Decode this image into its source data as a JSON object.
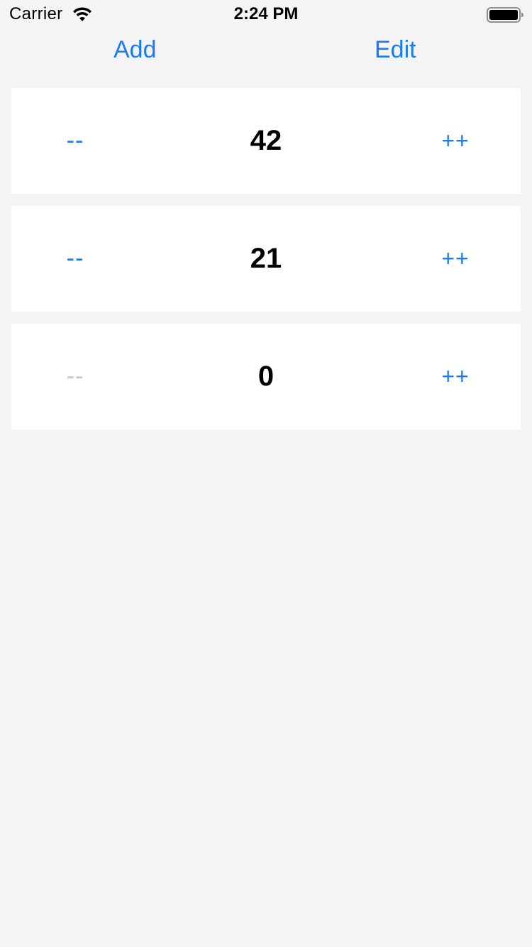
{
  "status_bar": {
    "carrier": "Carrier",
    "time": "2:24 PM"
  },
  "nav": {
    "add_label": "Add",
    "edit_label": "Edit"
  },
  "counters": [
    {
      "value": "42",
      "decrement_label": "--",
      "increment_label": "++",
      "decrement_enabled": true
    },
    {
      "value": "21",
      "decrement_label": "--",
      "increment_label": "++",
      "decrement_enabled": true
    },
    {
      "value": "0",
      "decrement_label": "--",
      "increment_label": "++",
      "decrement_enabled": false
    }
  ],
  "colors": {
    "accent": "#1a7cf0",
    "disabled": "#c8c8cc",
    "background": "#f4f4f4",
    "card": "#ffffff"
  }
}
